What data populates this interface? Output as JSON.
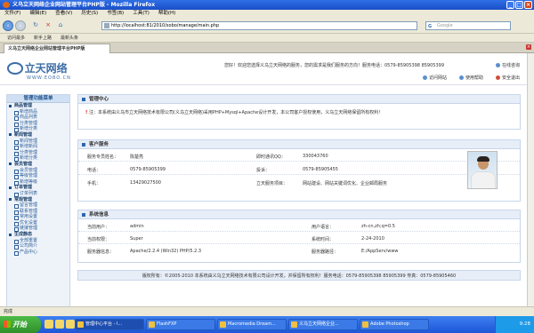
{
  "browser": {
    "window_title": "义乌立天网络企业网站管理平台PHP版 - Mozilla Firefox",
    "menu": [
      "文件(F)",
      "编辑(E)",
      "查看(V)",
      "历史(S)",
      "书签(B)",
      "工具(T)",
      "帮助(H)"
    ],
    "url": "http://localhost:81/2010/sobo/manage/main.php",
    "search_placeholder": "Google",
    "bookmarks": [
      "访问最多",
      "新手上路",
      "最新头条"
    ],
    "tab_title": "义乌立天网络企业网站管理平台PHP版",
    "status": "完成"
  },
  "site": {
    "logo_text": "立天网络",
    "logo_sub": "WWW.EOBO.CN",
    "welcome": "您好！欢迎您选择义乌立天网络的服务，您的需求是我们服务的方向！服务电话：0579-85905398  85905399",
    "online": "在线咨询",
    "links": [
      "访问网站",
      "使用帮助",
      "安全退出"
    ]
  },
  "sidebar": {
    "title": "管理功能菜单",
    "items": [
      {
        "t": "group",
        "label": "商品管理"
      },
      {
        "t": "item",
        "label": "新增商品"
      },
      {
        "t": "item",
        "label": "商品列表"
      },
      {
        "t": "item",
        "label": "分类管理"
      },
      {
        "t": "item",
        "label": "新增分类"
      },
      {
        "t": "group",
        "label": "新闻管理"
      },
      {
        "t": "item",
        "label": "新闻管理"
      },
      {
        "t": "item",
        "label": "新增新闻"
      },
      {
        "t": "item",
        "label": "分类管理"
      },
      {
        "t": "item",
        "label": "新增分类"
      },
      {
        "t": "group",
        "label": "会员管理"
      },
      {
        "t": "item",
        "label": "会员管理"
      },
      {
        "t": "item",
        "label": "等级管理"
      },
      {
        "t": "item",
        "label": "新增等级"
      },
      {
        "t": "group",
        "label": "订单管理"
      },
      {
        "t": "item",
        "label": "订单列表"
      },
      {
        "t": "group",
        "label": "常规管理"
      },
      {
        "t": "item",
        "label": "留言管理"
      },
      {
        "t": "item",
        "label": "联系管理"
      },
      {
        "t": "item",
        "label": "常用设置"
      },
      {
        "t": "item",
        "label": "优化设置"
      },
      {
        "t": "item",
        "label": "链接管理"
      },
      {
        "t": "group",
        "label": "生成静态"
      },
      {
        "t": "item",
        "label": "全部重置"
      },
      {
        "t": "item",
        "label": "公司简介"
      },
      {
        "t": "item",
        "label": "产品中心"
      }
    ]
  },
  "admin_center": {
    "title": "管理中心",
    "notice": "注：本系统由义乌市立天网络技术有限公司(义乌立天网络)采用PHP+Mysql+Apache设计开发，本公司客户授权使用，义乌立天网络保留所有权利!"
  },
  "service": {
    "title": "客户服务",
    "rows": [
      {
        "l1": "服务专员姓名：",
        "v1": "陈楚亮",
        "l2": "即时通讯QQ：",
        "v2": "330043760"
      },
      {
        "l1": "电话：",
        "v1": "0579-85905399",
        "l2": "投诉：",
        "v2": "0579-85905455"
      },
      {
        "l1": "手机：",
        "v1": "13429027500",
        "l2": "立天服务项目：",
        "v2": "网站建设、网站关键词优化、企业邮局服务"
      }
    ]
  },
  "sysinfo": {
    "title": "系统信息",
    "rows": [
      {
        "l1": "当前用户：",
        "v1": "admin",
        "l2": "用户语言：",
        "v2": "zh-cn,zh;q=0.5"
      },
      {
        "l1": "当前权限：",
        "v1": "Super",
        "l2": "系统时间：",
        "v2": "2-24-2010"
      },
      {
        "l1": "服务器信息：",
        "v1": "Apache/2.2.4 (Win32) PHP/5.2.3",
        "l2": "服务器路径：",
        "v2": "E:/AppServ/www"
      }
    ]
  },
  "footer": "版权所有：©2005-2010  本系统由义乌立天网络技术有限公司设计开发，并保留所有权利！服务电话：0579-85905398 85905399 传真：0579-85905460",
  "taskbar": {
    "start": "开始",
    "buttons": [
      "管理中心平台 - I...",
      "FlashFXP",
      "Macromedia Dream...",
      "义乌立天网络企业...",
      "Adobe Photoshop"
    ],
    "clock": "9:28"
  },
  "colors": {
    "accent": "#2b66b0",
    "panel_head": "#e7eef8",
    "title_bar": "#1a4fc7"
  }
}
